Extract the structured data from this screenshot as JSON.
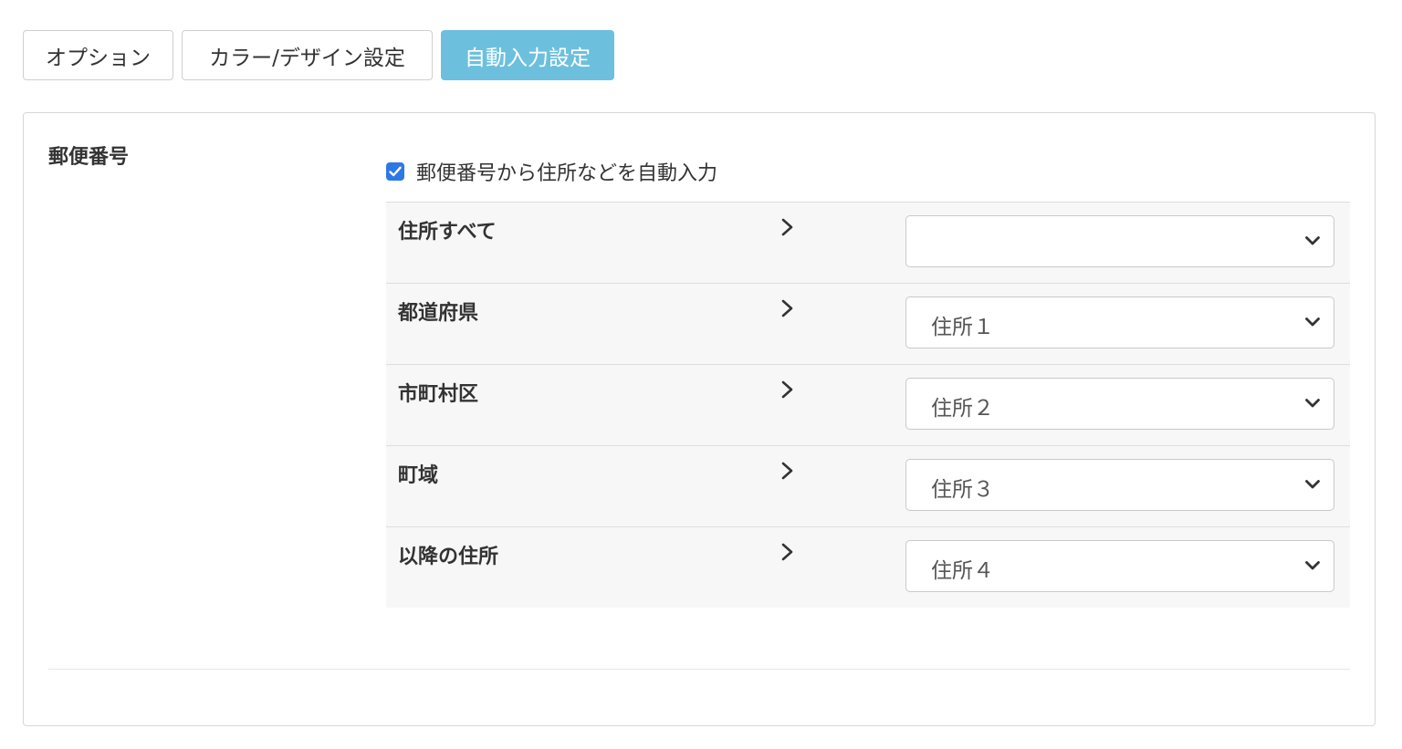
{
  "tabs": [
    {
      "label": "オプション",
      "active": false
    },
    {
      "label": "カラー/デザイン設定",
      "active": false
    },
    {
      "label": "自動入力設定",
      "active": true
    }
  ],
  "section": {
    "label": "郵便番号",
    "checkbox_label": "郵便番号から住所などを自動入力",
    "checkbox_checked": true
  },
  "rows": [
    {
      "label": "住所すべて",
      "select_value": ""
    },
    {
      "label": "都道府県",
      "select_value": "住所１"
    },
    {
      "label": "市町村区",
      "select_value": "住所２"
    },
    {
      "label": "町域",
      "select_value": "住所３"
    },
    {
      "label": "以降の住所",
      "select_value": "住所４"
    }
  ],
  "colors": {
    "active_tab": "#6cc0dd",
    "checkbox": "#2e78e6"
  },
  "icons": {
    "arrow": "chevron-right-icon",
    "select": "chevron-down-icon",
    "check": "check-icon"
  }
}
